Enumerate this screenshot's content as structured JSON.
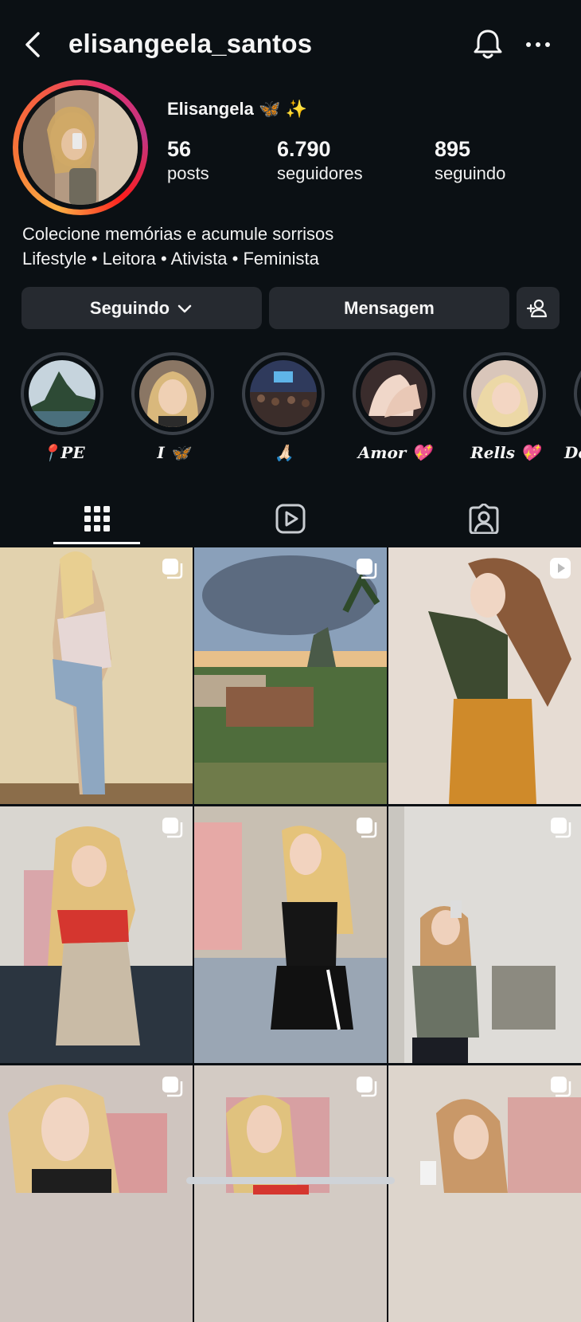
{
  "header": {
    "username": "elisangeela_santos"
  },
  "profile": {
    "display_name": "Elisangela 🦋 ✨",
    "stats": [
      {
        "value": "56",
        "label": "posts"
      },
      {
        "value": "6.790",
        "label": "seguidores"
      },
      {
        "value": "895",
        "label": "seguindo"
      }
    ],
    "bio_line1": "Colecione memórias e acumule sorrisos",
    "bio_line2": "Lifestyle • Leitora • Ativista • Feminista"
  },
  "actions": {
    "following_label": "Seguindo",
    "message_label": "Mensagem"
  },
  "highlights": [
    {
      "label": "📍PE"
    },
    {
      "label": "I 🦋"
    },
    {
      "label": "🙏🏻"
    },
    {
      "label": "Amor 💖"
    },
    {
      "label": "Rells 💖"
    },
    {
      "label": "Do"
    }
  ],
  "tabs": [
    "grid-icon",
    "reels-icon",
    "tagged-icon"
  ],
  "colors": {
    "background": "#0b1014",
    "button": "#262a30",
    "ring": "#3a4048"
  }
}
